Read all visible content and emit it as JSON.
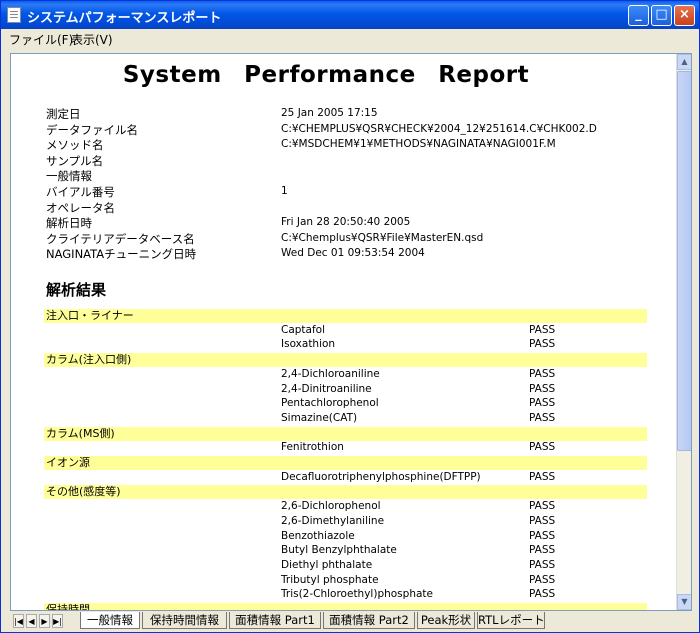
{
  "window": {
    "title": "システムパフォーマンスレポート",
    "buttons": {
      "minimize": "_",
      "maximize": "□",
      "close": "×"
    }
  },
  "menu": [
    {
      "label": "ファイル(F)"
    },
    {
      "label": "表示(V)"
    }
  ],
  "report": {
    "title": "System Performance Report",
    "info": [
      {
        "label": "測定日",
        "value": "25 Jan 2005  17:15"
      },
      {
        "label": "データファイル名",
        "value": "C:¥CHEMPLUS¥QSR¥CHECK¥2004_12¥251614.C¥CHK002.D"
      },
      {
        "label": "メソッド名",
        "value": "C:¥MSDCHEM¥1¥METHODS¥NAGINATA¥NAGI001F.M"
      },
      {
        "label": "サンプル名",
        "value": ""
      },
      {
        "label": "一般情報",
        "value": ""
      },
      {
        "label": "バイアル番号",
        "value": "1"
      },
      {
        "label": "オペレータ名",
        "value": ""
      },
      {
        "label": "解析日時",
        "value": "Fri Jan 28 20:50:40 2005"
      },
      {
        "label": "クライテリアデータベース名",
        "value": "C:¥Chemplus¥QSR¥File¥MasterEN.qsd"
      },
      {
        "label": "NAGINATAチューニング日時",
        "value": "Wed Dec 01 09:53:54 2004"
      }
    ],
    "results_heading": "解析結果",
    "categories": [
      {
        "name": "注入口・ライナー",
        "items": [
          {
            "compound": "Captafol",
            "result": "PASS"
          },
          {
            "compound": "Isoxathion",
            "result": "PASS"
          }
        ]
      },
      {
        "name": "カラム(注入口側)",
        "items": [
          {
            "compound": "2,4-Dichloroaniline",
            "result": "PASS"
          },
          {
            "compound": "2,4-Dinitroaniline",
            "result": "PASS"
          },
          {
            "compound": "Pentachlorophenol",
            "result": "PASS"
          },
          {
            "compound": "Simazine(CAT)",
            "result": "PASS"
          }
        ]
      },
      {
        "name": "カラム(MS側)",
        "items": [
          {
            "compound": "Fenitrothion",
            "result": "PASS"
          }
        ]
      },
      {
        "name": "イオン源",
        "items": [
          {
            "compound": "Decafluorotriphenylphosphine(DFTPP)",
            "result": "PASS"
          }
        ]
      },
      {
        "name": "その他(感度等)",
        "items": [
          {
            "compound": "2,6-Dichlorophenol",
            "result": "PASS"
          },
          {
            "compound": "2,6-Dimethylaniline",
            "result": "PASS"
          },
          {
            "compound": "Benzothiazole",
            "result": "PASS"
          },
          {
            "compound": "Butyl Benzylphthalate",
            "result": "PASS"
          },
          {
            "compound": "Diethyl phthalate",
            "result": "PASS"
          },
          {
            "compound": "Tributyl phosphate",
            "result": "PASS"
          },
          {
            "compound": "Tris(2-Chloroethyl)phosphate",
            "result": "PASS"
          }
        ]
      },
      {
        "name": "保持時間",
        "items": []
      }
    ]
  },
  "tabs": {
    "nav": [
      "|◀",
      "◀",
      "▶",
      "▶|"
    ],
    "sheets": [
      {
        "label": "一般情報",
        "active": true
      },
      {
        "label": "保持時間情報",
        "active": false
      },
      {
        "label": "面積情報 Part1",
        "active": false
      },
      {
        "label": "面積情報 Part2",
        "active": false
      },
      {
        "label": "Peak形状",
        "active": false
      },
      {
        "label": "RTLレポート",
        "active": false
      }
    ]
  }
}
